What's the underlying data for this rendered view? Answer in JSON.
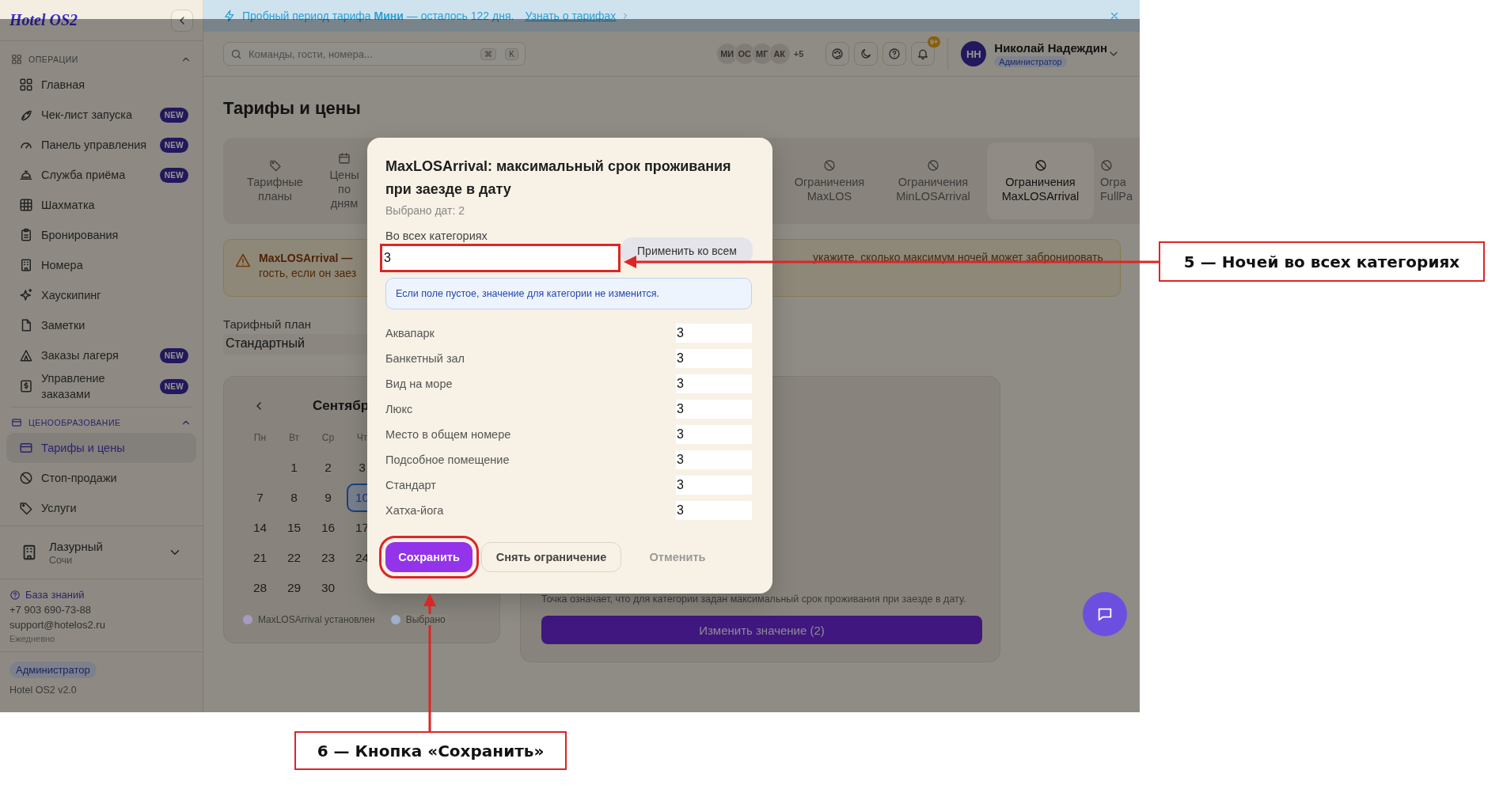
{
  "banner": {
    "text": "Пробный период тарифа **Мини** — осталось 122 дня.",
    "link": "Узнать о тарифах"
  },
  "sidebar": {
    "logo": "Hotel OS2",
    "sections": [
      {
        "title": "ОПЕРАЦИИ",
        "expanded": true,
        "items": [
          {
            "label": "Главная",
            "selected": false
          },
          {
            "label": "Чек-лист запуска",
            "badge": "NEW",
            "selected": false
          },
          {
            "label": "Панель управления",
            "badge": "NEW",
            "selected": false
          },
          {
            "label": "Служба приёма",
            "badge": "NEW",
            "selected": false
          },
          {
            "label": "Шахматка",
            "selected": false
          },
          {
            "label": "Бронирования",
            "selected": false
          },
          {
            "label": "Номера",
            "selected": false
          },
          {
            "label": "Хаускипинг",
            "selected": false
          },
          {
            "label": "Заметки",
            "selected": false
          },
          {
            "label": "Заказы лагеря",
            "badge": "NEW",
            "selected": false
          },
          {
            "label": "Управление заказами",
            "badge": "NEW",
            "selected": false
          }
        ]
      },
      {
        "title": "ЦЕНООБРАЗОВАНИЕ",
        "expanded": true,
        "items": [
          {
            "label": "Тарифы и цены",
            "selected": true
          },
          {
            "label": "Стоп-продажи",
            "selected": false
          },
          {
            "label": "Услуги",
            "selected": false
          }
        ]
      }
    ],
    "property": {
      "name": "Лазурный",
      "city": "Сочи"
    },
    "help": {
      "link": "База знаний",
      "phone": "+7 903 690-73-88",
      "email": "support@hotelos2.ru",
      "hours": "Ежедневно"
    },
    "role": "Администратор",
    "version": "Hotel OS2 v2.0"
  },
  "topbar": {
    "search_placeholder": "Команды, гости, номера...",
    "shortcut": [
      "⌘",
      "K"
    ],
    "avatars": [
      "МИ",
      "ОС",
      "МГ",
      "АК"
    ],
    "more": "+5",
    "notifications": "9+",
    "user": {
      "initials": "НН",
      "name": "Николай Надеждин",
      "role": "Администратор"
    }
  },
  "page": {
    "title": "Тарифы и цены",
    "tabs": [
      {
        "label": "Тарифные планы",
        "selected": false
      },
      {
        "label": "Цены по дням",
        "selected": false
      },
      {
        "label": "Ограничения MaxLOS",
        "selected": false
      },
      {
        "label": "Ограничения MinLOSArrival",
        "selected": false
      },
      {
        "label": "Ограничения MaxLOSArrival",
        "selected": true
      },
      {
        "label": "Огра FullPa",
        "selected": false
      }
    ],
    "warning": {
      "title": "MaxLOSArrival —",
      "line_2": "гость, если он заез",
      "text_right": "укажите, сколько максимум ночей может забронировать"
    },
    "plan": {
      "label": "Тарифный план",
      "value": "Стандартный"
    },
    "calendar": {
      "month": "Сентябр",
      "weekdays": [
        "Пн",
        "Вт",
        "Ср",
        "Чт"
      ],
      "weeks": [
        {
          "leading_blank": true,
          "days": [
            {
              "day": "1",
              "selected": false
            },
            {
              "day": "2",
              "selected": false
            },
            {
              "day": "3",
              "selected": false
            }
          ]
        },
        {
          "leading_blank": false,
          "days": [
            {
              "day": "7",
              "selected": false
            },
            {
              "day": "8",
              "selected": false
            },
            {
              "day": "9",
              "selected": false
            },
            {
              "day": "10",
              "selected": true
            }
          ]
        },
        {
          "leading_blank": false,
          "days": [
            {
              "day": "14",
              "selected": false
            },
            {
              "day": "15",
              "selected": false
            },
            {
              "day": "16",
              "selected": false
            },
            {
              "day": "17",
              "selected": false
            }
          ]
        },
        {
          "leading_blank": false,
          "days": [
            {
              "day": "21",
              "selected": false
            },
            {
              "day": "22",
              "selected": false
            },
            {
              "day": "23",
              "selected": false
            },
            {
              "day": "24",
              "selected": false
            }
          ]
        },
        {
          "leading_blank": false,
          "days": [
            {
              "day": "28",
              "selected": false
            },
            {
              "day": "29",
              "selected": false
            },
            {
              "day": "30",
              "selected": false
            }
          ]
        }
      ],
      "legend": [
        {
          "label": "MaxLOSArrival установлен",
          "color": "#a99bbf"
        },
        {
          "label": "Выбрано",
          "color": "#9fb0c9"
        }
      ]
    },
    "details": {
      "note": "Точка означает, что для категории задан максимальный срок проживания при заезде в дату.",
      "button": "Изменить значение (2)"
    }
  },
  "modal": {
    "title": "MaxLOSArrival: максимальный срок проживания при заезде в дату",
    "subtitle": "Выбрано дат: 2",
    "all_label": "Во всех категориях",
    "all_value": "3",
    "all_highlighted": true,
    "apply": "Применить ко всем",
    "hint": "Если поле пустое, значение для категории не изменится.",
    "categories": [
      {
        "name": "Аквапарк",
        "value": "3"
      },
      {
        "name": "Банкетный зал",
        "value": "3"
      },
      {
        "name": "Вид на море",
        "value": "3"
      },
      {
        "name": "Люкс",
        "value": "3"
      },
      {
        "name": "Место в общем номере",
        "value": "3"
      },
      {
        "name": "Подсобное помещение",
        "value": "3"
      },
      {
        "name": "Стандарт",
        "value": "3"
      },
      {
        "name": "Хатха-йога",
        "value": "3"
      }
    ],
    "buttons": [
      {
        "label": "Сохранить",
        "kind": "primary",
        "highlighted": true
      },
      {
        "label": "Снять ограничение",
        "kind": "outline",
        "highlighted": false
      },
      {
        "label": "Отменить",
        "kind": "text",
        "highlighted": false
      }
    ]
  },
  "callouts": [
    {
      "text": "5 — Ночей во всех категориях"
    },
    {
      "text": "6 — Кнопка «Сохранить»"
    }
  ]
}
